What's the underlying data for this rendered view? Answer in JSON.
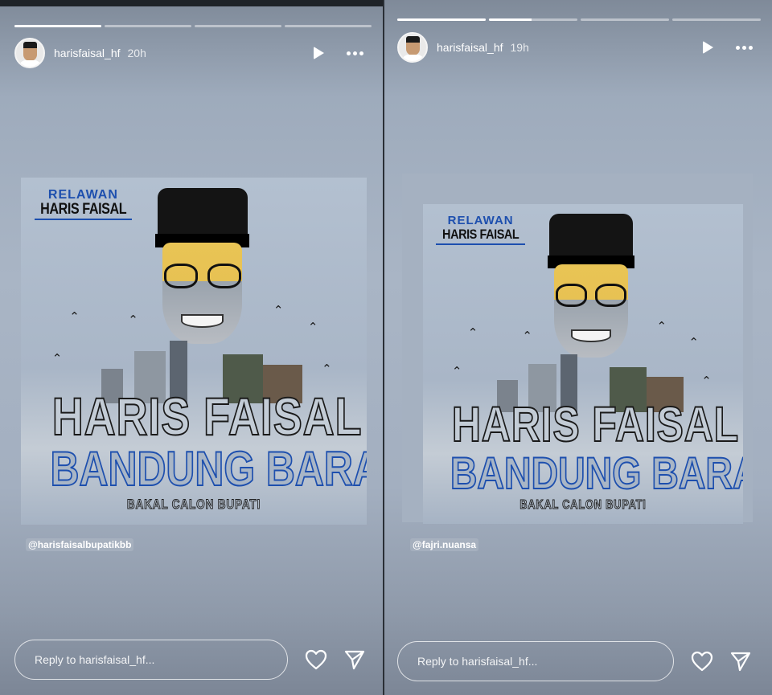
{
  "stories": [
    {
      "username": "harisfaisal_hf",
      "time": "20h",
      "progress": [
        1.0,
        0.0,
        0.0,
        0.0
      ],
      "poster": {
        "relawan": "RELAWAN",
        "name_small": "HARIS FAISAL",
        "line1": "HARIS FAISAL",
        "line2": "BANDUNG BARAT",
        "line3": "BAKAL CALON BUPATI"
      },
      "mention": "@harisfaisalbupatikbb",
      "reply_placeholder": "Reply to harisfaisal_hf..."
    },
    {
      "username": "harisfaisal_hf",
      "time": "19h",
      "progress": [
        1.0,
        0.48,
        0.0,
        0.0
      ],
      "poster": {
        "relawan": "RELAWAN",
        "name_small": "HARIS FAISAL",
        "line1": "HARIS FAISAL",
        "line2": "BANDUNG BARAT",
        "line3": "BAKAL CALON BUPATI"
      },
      "mention": "@fajri.nuansa",
      "reply_placeholder": "Reply to harisfaisal_hf..."
    }
  ],
  "icons": {
    "play": "play-icon",
    "more": "more-options-icon",
    "like": "heart-icon",
    "share": "send-icon"
  },
  "colors": {
    "accent_blue": "#1d4fae",
    "outline_dark": "#1a1a1a",
    "text_white": "#ffffff"
  }
}
